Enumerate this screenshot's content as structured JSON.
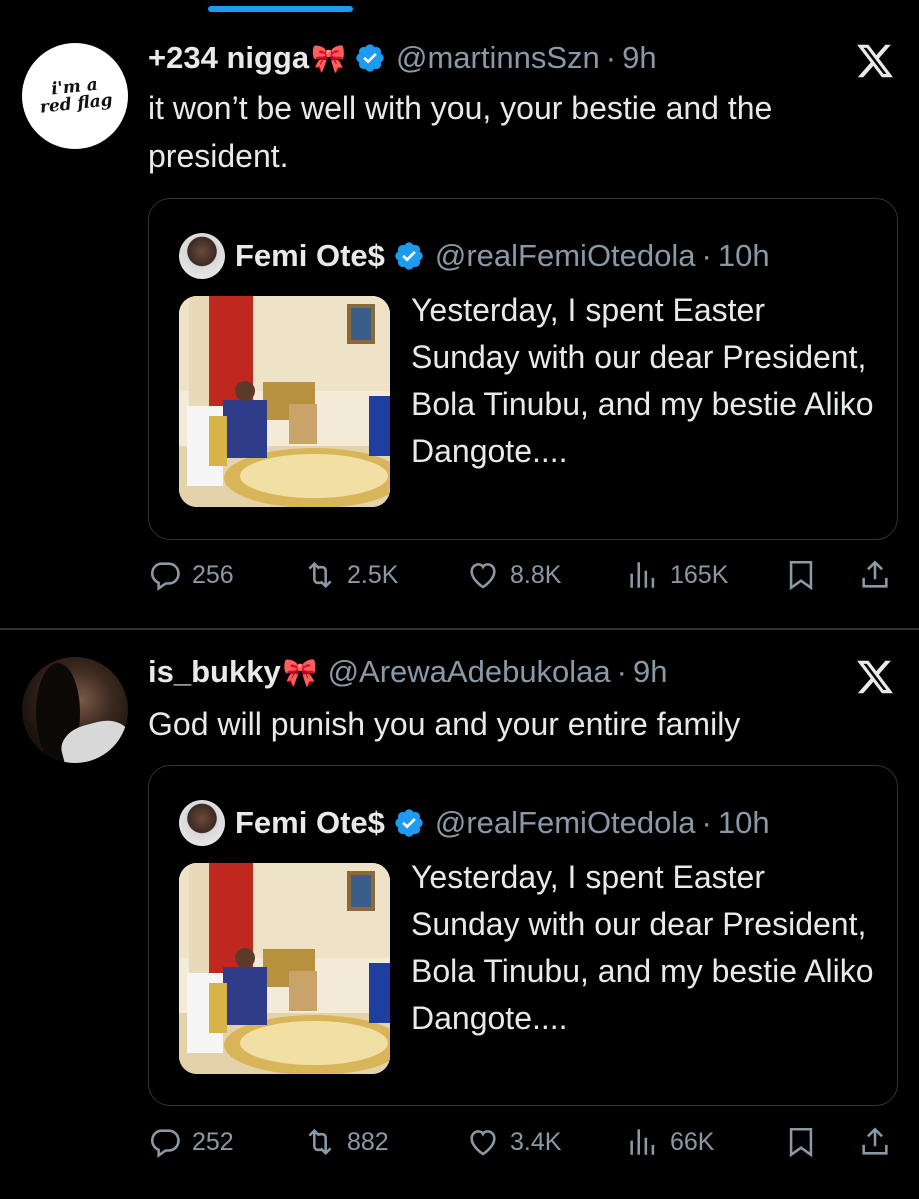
{
  "tweets": [
    {
      "avatar_text_1": "i'm a",
      "avatar_text_2": "red flag",
      "display_name": "+234 nigga",
      "ribbon": "🎀",
      "handle": "@martinnsSzn",
      "separator": "·",
      "time": "9h",
      "text": "it won’t be well with you, your bestie and the president.",
      "quote": {
        "name": "Femi Ote$",
        "handle": "@realFemiOtedola",
        "separator": "·",
        "time": "10h",
        "text": "Yesterday, I spent Easter Sunday with our dear President, Bola Tinubu, and my bestie Aliko Dangote...."
      },
      "stats": {
        "replies": "256",
        "reposts": "2.5K",
        "likes": "8.8K",
        "views": "165K"
      }
    },
    {
      "display_name": "is_bukky",
      "ribbon": "🎀",
      "handle": "@ArewaAdebukolaa",
      "separator": "·",
      "time": "9h",
      "text": "God will punish you and your entire family",
      "quote": {
        "name": "Femi Ote$",
        "handle": "@realFemiOtedola",
        "separator": "·",
        "time": "10h",
        "text": "Yesterday, I spent Easter Sunday with our dear President, Bola Tinubu, and my bestie Aliko Dangote...."
      },
      "stats": {
        "replies": "252",
        "reposts": "882",
        "likes": "3.4K",
        "views": "66K"
      }
    }
  ],
  "icons": {
    "verified": "verified-badge-icon",
    "x": "x-logo-icon",
    "reply": "reply-icon",
    "repost": "repost-icon",
    "like": "heart-icon",
    "views": "views-icon",
    "bookmark": "bookmark-icon",
    "share": "share-icon"
  },
  "colors": {
    "background": "#000000",
    "accent": "#1d9bf0",
    "muted": "#8b98a5",
    "text": "#e7e9ea",
    "border": "#2f3336"
  }
}
